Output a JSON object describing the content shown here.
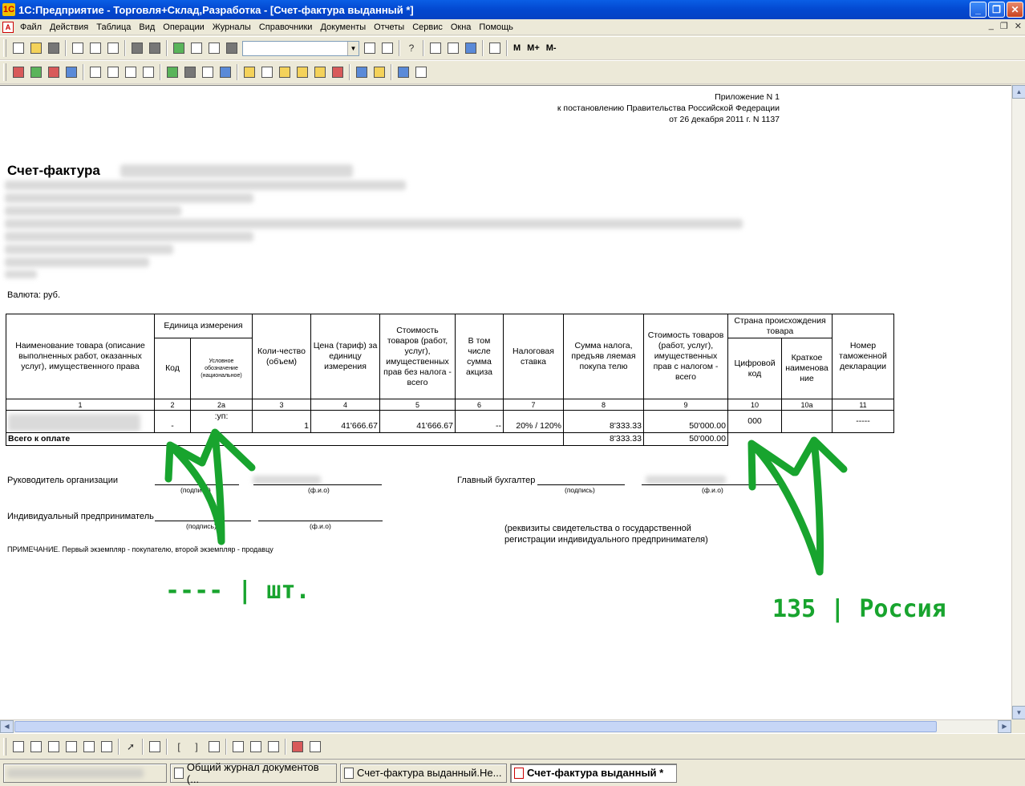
{
  "window": {
    "title": "1С:Предприятие - Торговля+Склад,Разработка - [Счет-фактура выданный  *]",
    "app_icon": "1С",
    "minimize": "_",
    "restore": "❐",
    "close": "✕"
  },
  "menu": {
    "items": [
      "Файл",
      "Действия",
      "Таблица",
      "Вид",
      "Операции",
      "Журналы",
      "Справочники",
      "Документы",
      "Отчеты",
      "Сервис",
      "Окна",
      "Помощь"
    ],
    "doc_icon": "А",
    "mdi_min": "_",
    "mdi_restore": "❐",
    "mdi_close": "✕"
  },
  "toolbar": {
    "m": "M",
    "m_plus": "M+",
    "m_minus": "M-",
    "help": "?"
  },
  "document": {
    "appendix": {
      "line1": "Приложение N 1",
      "line2": "к постановлению Правительства Российской Федерации",
      "line3": "от 26 декабря 2011 г. N 1137"
    },
    "title": "Счет-фактура",
    "currency": "Валюта: руб.",
    "headers": {
      "name": "Наименование товара (описание выполненных работ, оказанных услуг), имущественного права",
      "unit": "Единица измерения",
      "unit_code": "Код",
      "unit_symbol": "Условное обозначение (национальное)",
      "qty": "Коли-чество (объем)",
      "price": "Цена (тариф) за единицу измерения",
      "cost_no_tax": "Стоимость товаров (работ, услуг), имущественных прав без налога - всего",
      "excise": "В том числе сумма акциза",
      "tax_rate": "Налоговая ставка",
      "tax_sum": "Сумма налога, предъяв ляемая покупа телю",
      "cost_with_tax": "Стоимость товаров (работ, услуг), имущественных прав с налогом - всего",
      "country": "Страна происхождения товара",
      "country_code": "Цифровой код",
      "country_name": "Краткое наименова ние",
      "customs": "Номер таможенной декларации"
    },
    "col_numbers": [
      "1",
      "2",
      "2а",
      "3",
      "4",
      "5",
      "6",
      "7",
      "8",
      "9",
      "10",
      "10а",
      "11"
    ],
    "row": {
      "unit_code": "-",
      "unit_symbol": ":уп:",
      "qty": "1",
      "price": "41'666.67",
      "cost_no_tax": "41'666.67",
      "excise": "--",
      "tax_rate": "20% / 120%",
      "tax_sum": "8'333.33",
      "cost_with_tax": "50'000.00",
      "country_code": "000",
      "country_name": "",
      "customs": "-----"
    },
    "total": {
      "label": "Всего к оплате",
      "tax_sum": "8'333.33",
      "cost_with_tax": "50'000.00"
    },
    "signatures": {
      "head": "Руководитель организации",
      "chief_accountant": "Главный бухгалтер",
      "entrepreneur": "Индивидуальный предприниматель",
      "signature": "(подпись)",
      "fio": "(ф.и.о)",
      "requisites_line1": "(реквизиты свидетельства о государственной",
      "requisites_line2": "регистрации индивидуального предпринимателя)"
    },
    "note": "ПРИМЕЧАНИЕ. Первый экземпляр - покупателю, второй экземпляр - продавцу"
  },
  "annotations": {
    "left": "---- | шт.",
    "right": "135 | Россия",
    "color": "#18a42e"
  },
  "taskbar": {
    "items": [
      {
        "label": "Общий журнал документов (...",
        "active": false
      },
      {
        "label": "Счет-фактура выданный.Не...",
        "active": false
      },
      {
        "label": "Счет-фактура выданный  *",
        "active": true
      }
    ]
  }
}
